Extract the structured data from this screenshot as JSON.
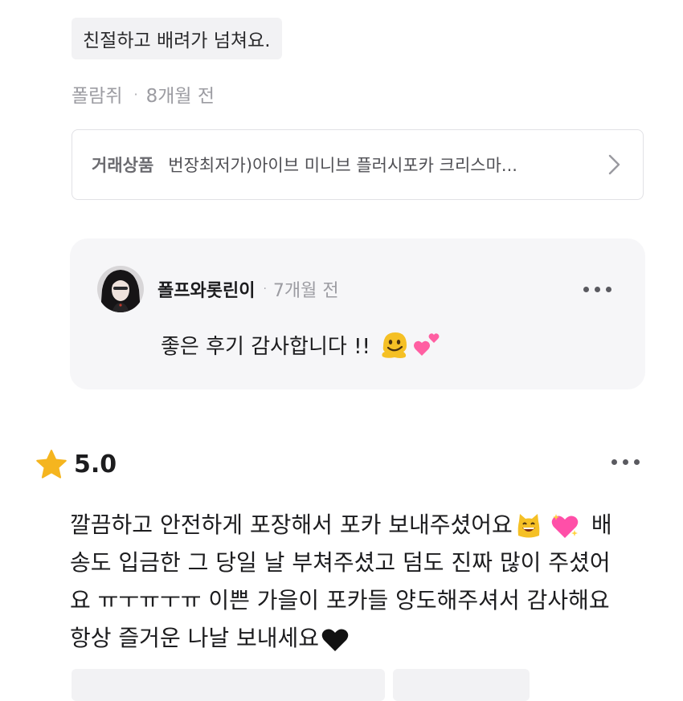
{
  "previous_review": {
    "tag": "친절하고 배려가 넘쳐요.",
    "reviewer": "폴람쥐",
    "separator": "·",
    "time": "8개월 전",
    "product": {
      "label": "거래상품",
      "name": "번장최저가)아이브 미니브 플러시포카 크리스마..."
    },
    "reply": {
      "username": "폴프와롯린이",
      "separator": "·",
      "time": "7개월 전",
      "text": "좋은 후기 감사합니다 !!"
    }
  },
  "review": {
    "score": "5.0",
    "lines": [
      "깔끔하고 안전하게 포장해서 포카 보내주셨어요",
      "배",
      "송도 입금한 그 당일 날 부쳐주셨고 덤도 진짜 많이 주셨어",
      "요 ㅠㅜㅠㅜㅠ 이쁜 가을이 포카들 양도해주셔서 감사해요",
      "항상 즐거운 나날 보내세요"
    ]
  },
  "icons": {
    "star": "star-icon",
    "more": "more-dots-icon",
    "chevron": "chevron-right-icon",
    "melting_face": "melting-face-emoji",
    "two_hearts": "two-hearts-emoji",
    "grinning_cat": "grinning-cat-emoji",
    "sparkling_heart": "sparkling-heart-emoji",
    "black_heart": "black-heart-emoji"
  },
  "colors": {
    "star": "#f5b51f",
    "muted_text": "#9c9ca2",
    "reply_bg": "#f6f6f8",
    "pill_bg": "#f2f2f4"
  }
}
